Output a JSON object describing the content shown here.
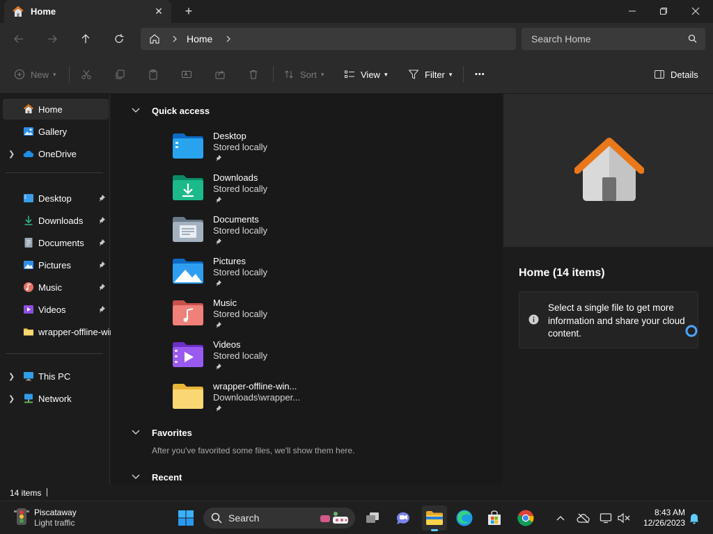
{
  "tab": {
    "label": "Home",
    "close": "✕",
    "new": "+"
  },
  "nav": {
    "breadcrumb": "Home",
    "search_placeholder": "Search Home"
  },
  "commands": {
    "new": "New",
    "sort": "Sort",
    "view": "View",
    "filter": "Filter",
    "more": "•••",
    "details": "Details"
  },
  "sidebar": {
    "items": [
      {
        "label": "Home"
      },
      {
        "label": "Gallery"
      },
      {
        "label": "OneDrive"
      },
      {
        "label": "Desktop"
      },
      {
        "label": "Downloads"
      },
      {
        "label": "Documents"
      },
      {
        "label": "Pictures"
      },
      {
        "label": "Music"
      },
      {
        "label": "Videos"
      },
      {
        "label": "wrapper-offline-win"
      },
      {
        "label": "This PC"
      },
      {
        "label": "Network"
      }
    ]
  },
  "main": {
    "quick_access": "Quick access",
    "items": [
      {
        "name": "Desktop",
        "sub": "Stored locally"
      },
      {
        "name": "Downloads",
        "sub": "Stored locally"
      },
      {
        "name": "Documents",
        "sub": "Stored locally"
      },
      {
        "name": "Pictures",
        "sub": "Stored locally"
      },
      {
        "name": "Music",
        "sub": "Stored locally"
      },
      {
        "name": "Videos",
        "sub": "Stored locally"
      },
      {
        "name": "wrapper-offline-win...",
        "sub": "Downloads\\wrapper..."
      }
    ],
    "favorites": "Favorites",
    "favorites_empty": "After you've favorited some files, we'll show them here.",
    "recent": "Recent"
  },
  "details": {
    "title": "Home (14 items)",
    "info": "Select a single file to get more information and share your cloud content."
  },
  "status": {
    "count": "14 items"
  },
  "taskbar": {
    "weather_city": "Piscataway",
    "weather_status": "Light traffic",
    "search_label": "Search",
    "time": "8:43 AM",
    "date": "12/26/2023"
  },
  "colors": {
    "accent": "#0078d4",
    "folder_yellow": "#f8d775",
    "home_orange": "#e8781a"
  }
}
